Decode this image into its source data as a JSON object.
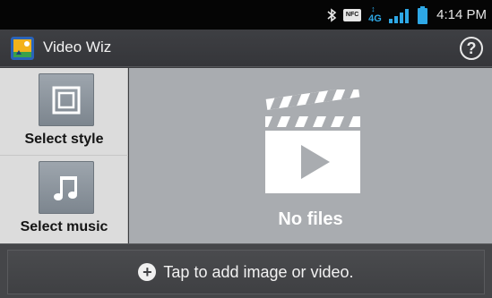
{
  "status_bar": {
    "time": "4:14 PM",
    "nfc_label": "NFC",
    "network_label": "4G",
    "icons": [
      "bluetooth-icon",
      "nfc-icon",
      "4g-data-icon",
      "signal-icon",
      "battery-icon"
    ]
  },
  "app_bar": {
    "title": "Video Wiz",
    "help_label": "?"
  },
  "side_panel": {
    "items": [
      {
        "label": "Select style",
        "icon": "frame-icon"
      },
      {
        "label": "Select music",
        "icon": "music-note-icon"
      }
    ]
  },
  "preview": {
    "empty_label": "No files",
    "icon": "clapperboard-play-icon"
  },
  "bottom": {
    "add_label": "Tap to add image or video.",
    "add_icon": "+"
  },
  "colors": {
    "status_bar": "#050505",
    "action_bar": "#3b3c3f",
    "side_panel": "#dcdcdc",
    "preview": "#a9acb0",
    "side_button": "#8b939b",
    "network_accent": "#2ea8e6"
  }
}
